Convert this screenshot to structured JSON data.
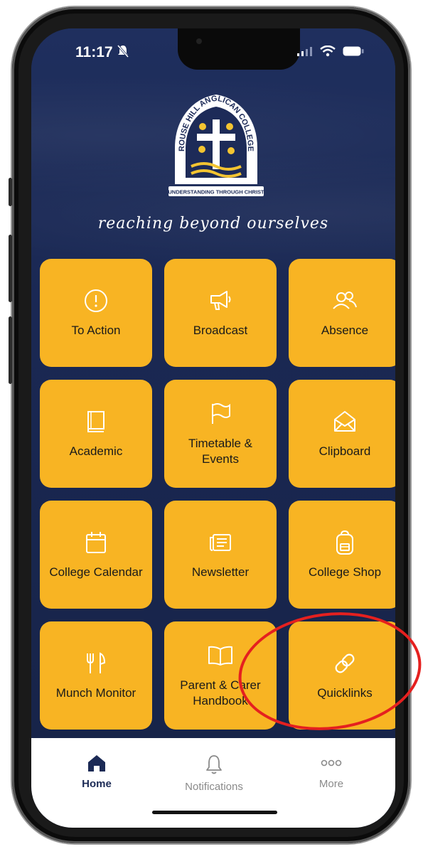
{
  "status": {
    "time": "11:17"
  },
  "app": {
    "tagline": "reaching beyond ourselves",
    "crest": {
      "name": "ROUSE HILL ANGLICAN COLLEGE",
      "motto": "UNDERSTANDING THROUGH CHRIST"
    }
  },
  "tiles": [
    {
      "label": "To Action",
      "icon": "alert-circle-icon"
    },
    {
      "label": "Broadcast",
      "icon": "megaphone-icon"
    },
    {
      "label": "Absence",
      "icon": "people-icon"
    },
    {
      "label": "Academic",
      "icon": "book-icon"
    },
    {
      "label": "Timetable & Events",
      "icon": "flag-icon"
    },
    {
      "label": "Clipboard",
      "icon": "envelope-open-icon"
    },
    {
      "label": "College Calendar",
      "icon": "calendar-icon"
    },
    {
      "label": "Newsletter",
      "icon": "newspaper-icon"
    },
    {
      "label": "College Shop",
      "icon": "backpack-icon"
    },
    {
      "label": "Munch Monitor",
      "icon": "fork-knife-icon"
    },
    {
      "label": "Parent & Carer Handbook",
      "icon": "open-book-icon"
    },
    {
      "label": "Quicklinks",
      "icon": "link-icon"
    }
  ],
  "tabbar": {
    "home": "Home",
    "notifications": "Notifications",
    "more": "More"
  },
  "colors": {
    "tile": "#f8b423",
    "background": "#1b2a55",
    "highlight": "#e5201f"
  }
}
